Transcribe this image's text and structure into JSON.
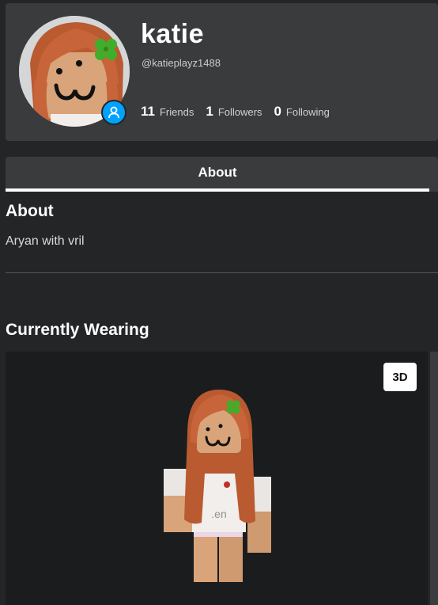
{
  "profile": {
    "display_name": "katie",
    "username": "@katieplayz1488"
  },
  "stats": [
    {
      "value": "11",
      "label": "Friends"
    },
    {
      "value": "1",
      "label": "Followers"
    },
    {
      "value": "0",
      "label": "Following"
    }
  ],
  "tabs": {
    "about_label": "About"
  },
  "about": {
    "heading": "About",
    "text": "Aryan with vril"
  },
  "wearing": {
    "heading": "Currently Wearing",
    "toggle_3d_label": "3D"
  },
  "colors": {
    "background": "#232527",
    "panel": "#393b3d",
    "accent_blue": "#00a2ff",
    "hair": "#c8643a",
    "skin": "#d9a47a",
    "clover": "#3fae2a"
  },
  "icons": {
    "status": "person-icon",
    "accessory": "clover-icon"
  }
}
